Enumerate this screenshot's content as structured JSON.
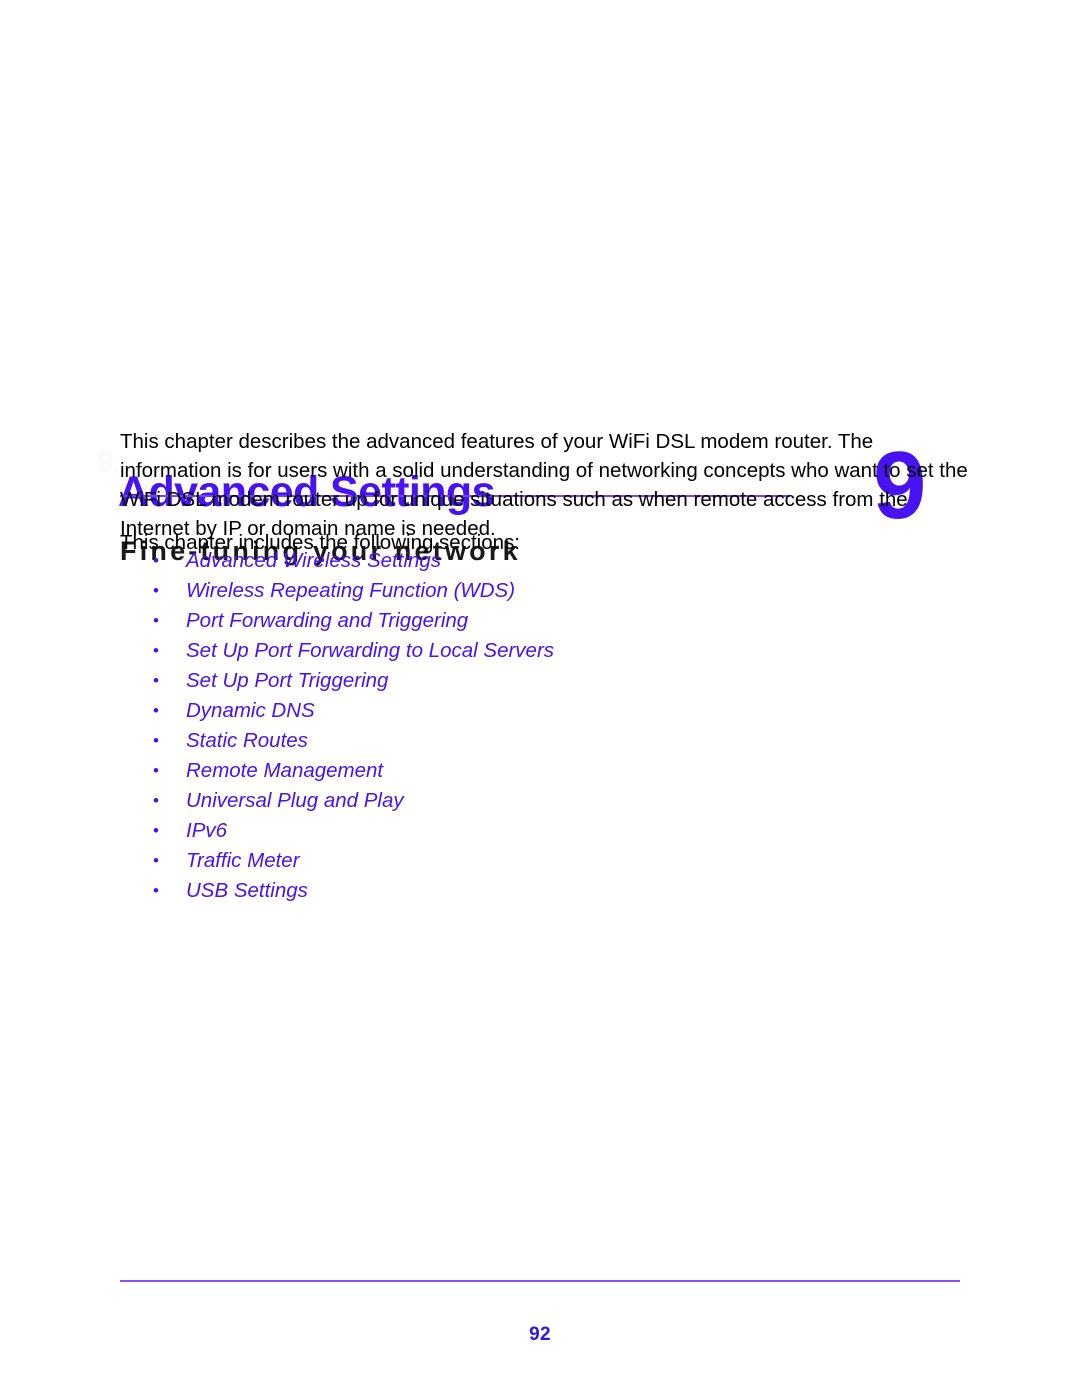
{
  "document": {
    "chapter_number": "9",
    "chapter_watermark": "9.",
    "title": "Advanced Settings",
    "subtitle": "Fine-tuning your network"
  },
  "body": {
    "intro_paragraph": "This chapter describes the advanced features of your WiFi DSL modem router. The information is for users with a solid understanding of networking concepts who want to set the WiFi DSL modem router up for unique situations such as when remote access from the Internet by IP or domain name is needed.",
    "sections_lead": "This chapter includes the following sections:",
    "bullet_glyph": "•",
    "sections": [
      {
        "label": "Advanced Wireless Settings"
      },
      {
        "label": "Wireless Repeating Function (WDS)"
      },
      {
        "label": "Port Forwarding and Triggering"
      },
      {
        "label": "Set Up Port Forwarding to Local Servers"
      },
      {
        "label": "Set Up Port Triggering"
      },
      {
        "label": "Dynamic DNS"
      },
      {
        "label": "Static Routes"
      },
      {
        "label": "Remote Management"
      },
      {
        "label": "Universal Plug and Play"
      },
      {
        "label": "IPv6"
      },
      {
        "label": "Traffic Meter"
      },
      {
        "label": "USB Settings"
      }
    ]
  },
  "footer": {
    "page_number": "92"
  },
  "colors": {
    "accent_violet": "#4713f0",
    "rule_violet": "#7b3ff5",
    "footer_rule_violet": "#8b4ff7",
    "body_text": "#000000",
    "subtitle_text": "#1a1a1a",
    "watermark": "#fafafa",
    "page_background": "#ffffff"
  }
}
